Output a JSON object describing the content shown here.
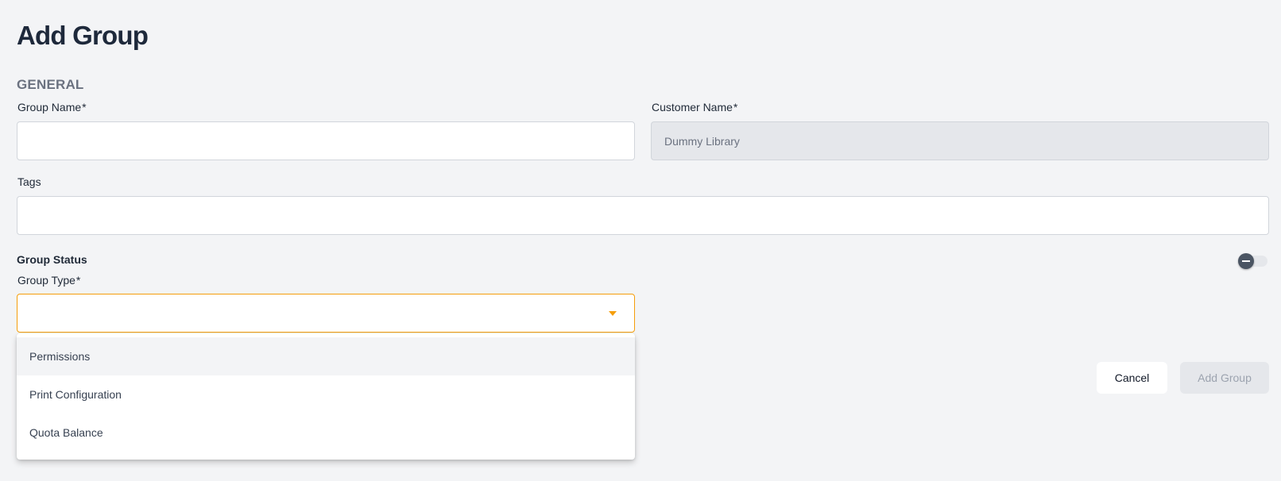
{
  "page": {
    "title": "Add Group",
    "section": "GENERAL"
  },
  "fields": {
    "group_name": {
      "label": "Group Name",
      "required_mark": "*",
      "value": ""
    },
    "customer_name": {
      "label": "Customer Name",
      "required_mark": "*",
      "value": "Dummy Library"
    },
    "tags": {
      "label": "Tags",
      "value": ""
    },
    "group_status": {
      "label": "Group Status",
      "enabled": false
    },
    "group_type": {
      "label": "Group Type",
      "required_mark": "*",
      "value": "",
      "options": [
        "Permissions",
        "Print Configuration",
        "Quota Balance"
      ],
      "highlighted_option": "Permissions"
    }
  },
  "actions": {
    "cancel_label": "Cancel",
    "add_label": "Add Group"
  },
  "colors": {
    "accent": "#f59e0b",
    "background": "#f3f4f6",
    "title": "#1e293b"
  },
  "icons": {
    "select_caret": "caret-down-icon",
    "toggle_knob": "minus-icon"
  }
}
